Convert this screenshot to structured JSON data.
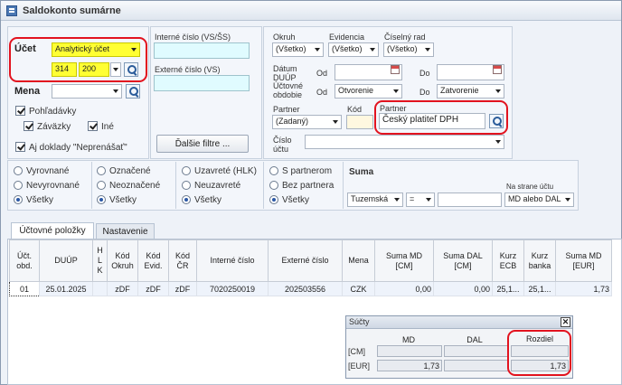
{
  "window": {
    "title": "Saldokonto sumárne"
  },
  "ucet": {
    "label": "Účet",
    "type_value": "Analytický účet",
    "synt": "314",
    "anal": "200"
  },
  "mena": {
    "label": "Mena",
    "value": ""
  },
  "checks": {
    "pohladavky": {
      "label": "Pohľadávky",
      "checked": true
    },
    "zavazky": {
      "label": "Záväzky",
      "checked": true
    },
    "ine": {
      "label": "Iné",
      "checked": true
    },
    "neprenasat": {
      "label": "Aj doklady \"Neprenášať\"",
      "checked": true
    }
  },
  "interne": {
    "label": "Interné číslo (VS/ŠS)",
    "value": ""
  },
  "externe": {
    "label": "Externé číslo (VS)",
    "value": ""
  },
  "dalsie_filtre": "Ďalšie filtre ...",
  "okruh": {
    "label": "Okruh",
    "value": "(Všetko)"
  },
  "evidencia": {
    "label": "Evidencia",
    "value": "(Všetko)"
  },
  "ciselny_rad": {
    "label": "Číselný rad",
    "value": "(Všetko)"
  },
  "datum_duup": {
    "label1": "Dátum",
    "label2": "DUÚP",
    "od": "Od",
    "do": "Do",
    "od_value": "",
    "do_value": ""
  },
  "uctovne_obdobie": {
    "label1": "Účtovné",
    "label2": "obdobie",
    "od": "Od",
    "do": "Do",
    "od_value": "Otvorenie",
    "do_value": "Zatvorenie"
  },
  "partner": {
    "label": "Partner",
    "type_value": "(Zadaný)",
    "kod_label": "Kód",
    "kod_value": "",
    "name_label": "Partner",
    "name_value": "Český platiteľ DPH"
  },
  "cislo_uctu": {
    "label1": "Číslo",
    "label2": "účtu",
    "value": ""
  },
  "radio_groups": [
    {
      "options": [
        "Vyrovnané",
        "Nevyrovnané",
        "Všetky"
      ],
      "selected": 2
    },
    {
      "options": [
        "Označené",
        "Neoznačené",
        "Všetky"
      ],
      "selected": 2
    },
    {
      "options": [
        "Uzavreté (HLK)",
        "Neuzavreté",
        "Všetky"
      ],
      "selected": 2
    },
    {
      "options": [
        "S partnerom",
        "Bez partnera",
        "Všetky"
      ],
      "selected": 2
    }
  ],
  "suma": {
    "label": "Suma",
    "mena_value": "Tuzemská",
    "op_value": "=",
    "amount": "",
    "strana_label": "Na strane účtu",
    "strana_value": "MD alebo DAL"
  },
  "tabs": [
    {
      "label": "Účtovné položky",
      "active": true
    },
    {
      "label": "Nastavenie",
      "active": false
    }
  ],
  "table": {
    "headers": {
      "uct_obd": [
        "Účt.",
        "obd."
      ],
      "duup": "DUÚP",
      "hlk": [
        "H",
        "L",
        "K"
      ],
      "okruh": [
        "Kód",
        "Okruh"
      ],
      "evid": [
        "Kód",
        "Evid."
      ],
      "cr": [
        "Kód",
        "ČR"
      ],
      "interne": "Interné číslo",
      "externe": "Externé číslo",
      "mena": "Mena",
      "suma_md": [
        "Suma MD",
        "[CM]"
      ],
      "suma_dal": [
        "Suma DAL",
        "[CM]"
      ],
      "kurz_ecb": [
        "Kurz",
        "ECB"
      ],
      "kurz_banka": [
        "Kurz",
        "banka"
      ],
      "suma_md_eur": [
        "Suma MD",
        "[EUR]"
      ]
    },
    "rows": [
      {
        "obd": "01",
        "duup": "25.01.2025",
        "hlk": "",
        "okruh": "zDF",
        "evid": "zDF",
        "cr": "zDF",
        "interne": "7020250019",
        "externe": "202503556",
        "mena": "CZK",
        "suma_md": "0,00",
        "suma_dal": "0,00",
        "kurz_ecb": "25,1...",
        "kurz_banka": "25,1...",
        "suma_md_eur": "1,73"
      }
    ]
  },
  "sucty": {
    "title": "Súčty",
    "col_md": "MD",
    "col_dal": "DAL",
    "col_rozdiel": "Rozdiel",
    "row_cm": "[CM]",
    "row_eur": "[EUR]",
    "cm_md": "",
    "cm_dal": "",
    "cm_rozdiel": "",
    "eur_md": "1,73",
    "eur_dal": "",
    "eur_rozdiel": "1,73"
  },
  "colors": {
    "highlight": "#ffff33",
    "input_cyan": "#e0fbff",
    "annotation": "#e2131f"
  }
}
